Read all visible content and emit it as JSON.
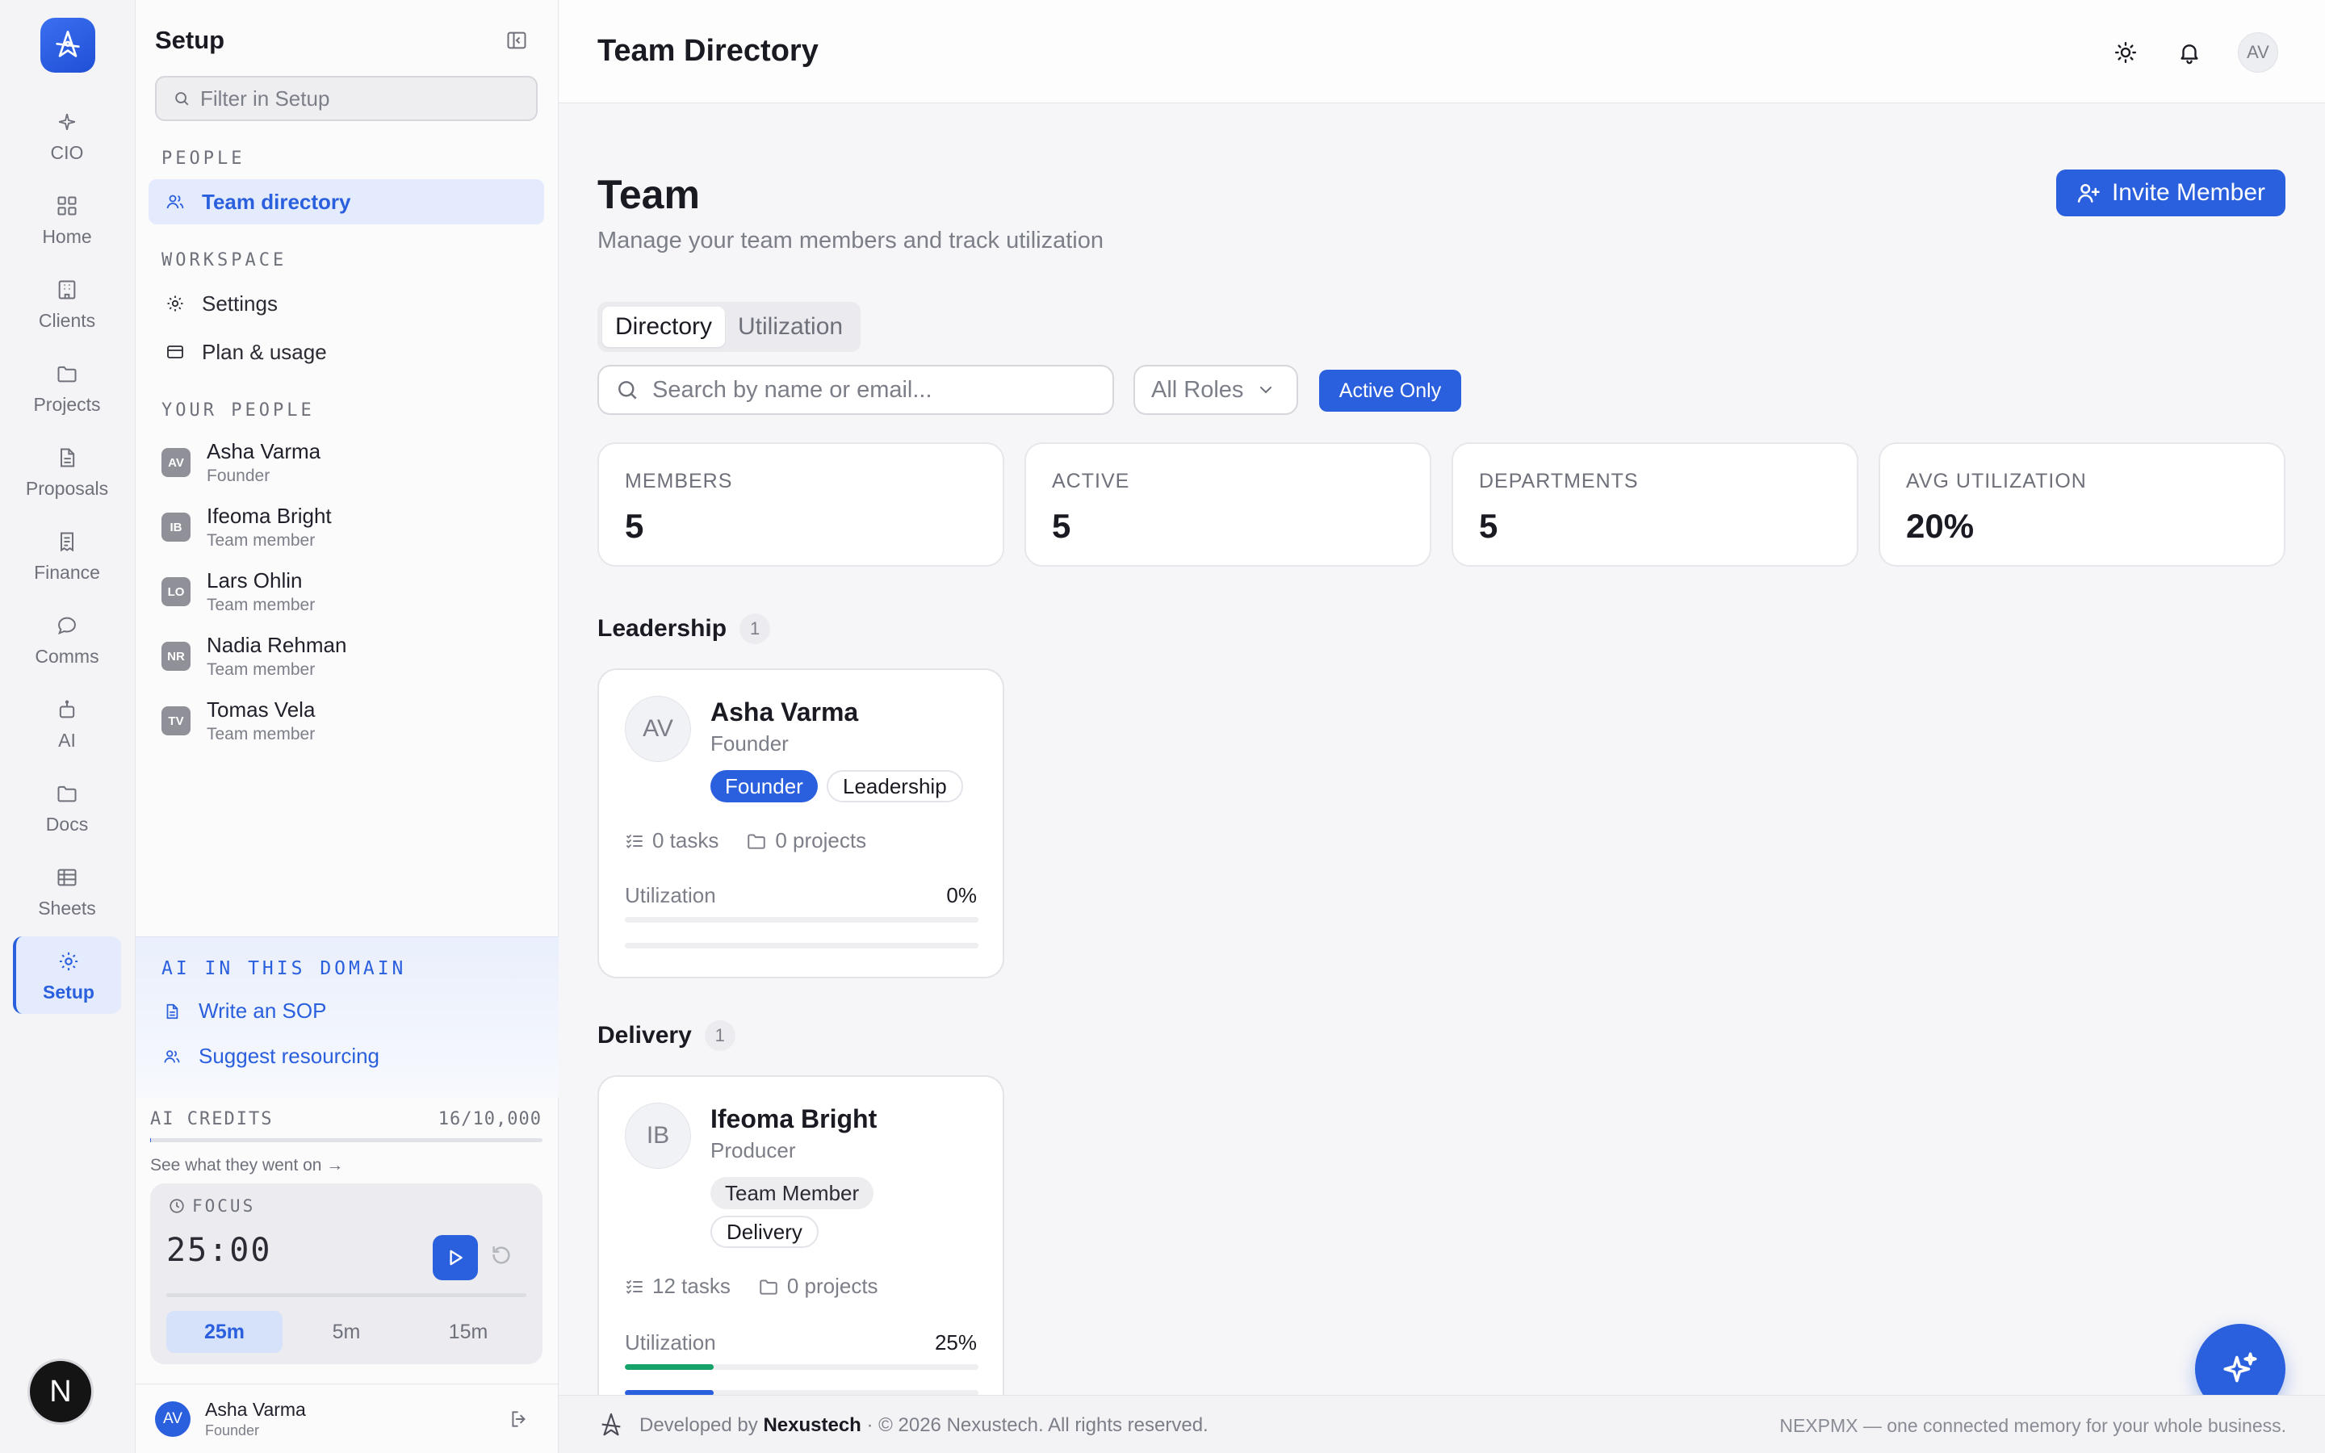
{
  "rail": {
    "items": [
      {
        "label": "CIO",
        "icon": "sparkle-icon"
      },
      {
        "label": "Home",
        "icon": "grid-icon"
      },
      {
        "label": "Clients",
        "icon": "building-icon"
      },
      {
        "label": "Projects",
        "icon": "folder-icon"
      },
      {
        "label": "Proposals",
        "icon": "document-icon"
      },
      {
        "label": "Finance",
        "icon": "receipt-icon"
      },
      {
        "label": "Comms",
        "icon": "chat-icon"
      },
      {
        "label": "AI",
        "icon": "robot-icon"
      },
      {
        "label": "Docs",
        "icon": "folder-icon"
      },
      {
        "label": "Sheets",
        "icon": "table-icon"
      },
      {
        "label": "Setup",
        "icon": "gear-icon",
        "active": true
      }
    ],
    "badge": "N"
  },
  "setup": {
    "title": "Setup",
    "filter_placeholder": "Filter in Setup",
    "people_label": "PEOPLE",
    "team_directory": "Team directory",
    "workspace_label": "WORKSPACE",
    "settings": "Settings",
    "plan_usage": "Plan & usage",
    "your_people_label": "YOUR PEOPLE",
    "people": [
      {
        "initials": "AV",
        "name": "Asha Varma",
        "role": "Founder"
      },
      {
        "initials": "IB",
        "name": "Ifeoma Bright",
        "role": "Team member"
      },
      {
        "initials": "LO",
        "name": "Lars Ohlin",
        "role": "Team member"
      },
      {
        "initials": "NR",
        "name": "Nadia Rehman",
        "role": "Team member"
      },
      {
        "initials": "TV",
        "name": "Tomas Vela",
        "role": "Team member"
      }
    ],
    "ai_domain": {
      "label": "AI IN THIS DOMAIN",
      "links": [
        "Write an SOP",
        "Suggest resourcing"
      ]
    },
    "credits": {
      "label": "AI CREDITS",
      "value": "16/10,000",
      "used_fraction": 0.0016,
      "link": "See what they went on →"
    },
    "focus": {
      "label": "FOCUS",
      "time": "25:00",
      "options": [
        "25m",
        "5m",
        "15m"
      ],
      "selected": "25m"
    },
    "user": {
      "initials": "AV",
      "name": "Asha Varma",
      "role": "Founder"
    }
  },
  "topbar": {
    "title": "Team Directory",
    "avatar": "AV"
  },
  "main": {
    "heading": "Team",
    "subheading": "Manage your team members and track utilization",
    "invite_label": "Invite Member",
    "tabs": [
      "Directory",
      "Utilization"
    ],
    "selected_tab": "Directory",
    "search_placeholder": "Search by name or email...",
    "roles_filter": "All Roles",
    "active_only": "Active Only",
    "stats": [
      {
        "label": "MEMBERS",
        "value": "5"
      },
      {
        "label": "ACTIVE",
        "value": "5"
      },
      {
        "label": "DEPARTMENTS",
        "value": "5"
      },
      {
        "label": "AVG UTILIZATION",
        "value": "20%"
      }
    ],
    "groups": [
      {
        "name": "Leadership",
        "count": "1",
        "member": {
          "initials": "AV",
          "name": "Asha Varma",
          "role": "Founder",
          "badges": [
            "Founder",
            "Leadership"
          ],
          "tasks": "0 tasks",
          "projects": "0 projects",
          "utilization_label": "Utilization",
          "utilization_value": "0%",
          "utilization": 0
        }
      },
      {
        "name": "Delivery",
        "count": "1",
        "member": {
          "initials": "IB",
          "name": "Ifeoma Bright",
          "role": "Producer",
          "badges": [
            "Team Member",
            "Delivery"
          ],
          "tasks": "12 tasks",
          "projects": "0 projects",
          "utilization_label": "Utilization",
          "utilization_value": "25%",
          "utilization": 25
        }
      }
    ]
  },
  "footer": {
    "developed_by": "Developed by",
    "brand": "Nexustech",
    "copyright": "· © 2026 Nexustech. All rights reserved.",
    "tagline": "NEXPMX — one connected memory for your whole business."
  },
  "colors": {
    "accent": "#2a5fdd",
    "util_green": "#16a36a"
  }
}
